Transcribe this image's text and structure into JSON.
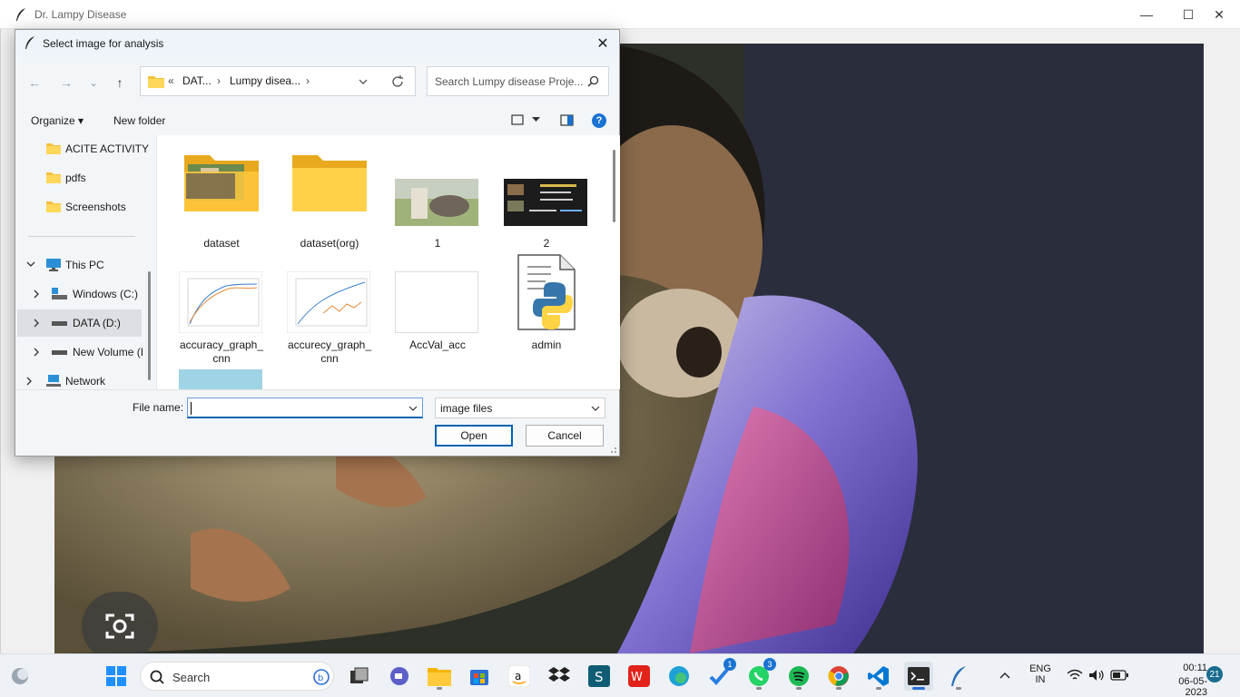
{
  "app": {
    "title": "Dr. Lampy Disease",
    "controls": {
      "minimize": "—",
      "maximize": "☐",
      "close": "✕"
    }
  },
  "dialog": {
    "title": "Select image for analysis",
    "close": "✕",
    "nav": {
      "back": "←",
      "forward": "→",
      "recent": "⌄",
      "up": "↑"
    },
    "address": {
      "prefix": "«",
      "crumbs": [
        "DAT...",
        "Lumpy disea..."
      ],
      "separator": "›"
    },
    "search_placeholder": "Search Lumpy disease Proje...",
    "commands": {
      "organize": "Organize",
      "organize_arrow": "▾",
      "new_folder": "New folder",
      "help": "?"
    },
    "nav_pane": [
      {
        "label": "ACITE ACTIVITY",
        "icon": "folder-icon"
      },
      {
        "label": "pdfs",
        "icon": "folder-icon"
      },
      {
        "label": "Screenshots",
        "icon": "folder-icon"
      },
      {
        "label": "This PC",
        "icon": "computer-icon",
        "expanded": true
      },
      {
        "label": "Windows (C:)",
        "icon": "drive-icon"
      },
      {
        "label": "DATA (D:)",
        "icon": "drive-icon",
        "selected": true
      },
      {
        "label": "New Volume (I",
        "icon": "drive-icon"
      },
      {
        "label": "Network",
        "icon": "network-icon"
      }
    ],
    "files": [
      {
        "label": "dataset",
        "kind": "folder-photo"
      },
      {
        "label": "dataset(org)",
        "kind": "folder"
      },
      {
        "label": "1",
        "kind": "image-photo"
      },
      {
        "label": "2",
        "kind": "image-dark"
      },
      {
        "label": "accuracy_graph_\ncnn",
        "kind": "graph"
      },
      {
        "label": "accurecy_graph_\ncnn",
        "kind": "graph2"
      },
      {
        "label": "AccVal_acc",
        "kind": "blank"
      },
      {
        "label": "admin",
        "kind": "python"
      }
    ],
    "file_name_label": "File name:",
    "file_name_value": "",
    "file_type": "image files",
    "open_button": "Open",
    "cancel_button": "Cancel"
  },
  "taskbar": {
    "search_placeholder": "Search",
    "whatsapp_badge": "3",
    "todo_badge": "1",
    "language": {
      "line1": "ENG",
      "line2": "IN"
    },
    "time": "00:11",
    "date": "06-05-2023",
    "notifications": "21"
  }
}
